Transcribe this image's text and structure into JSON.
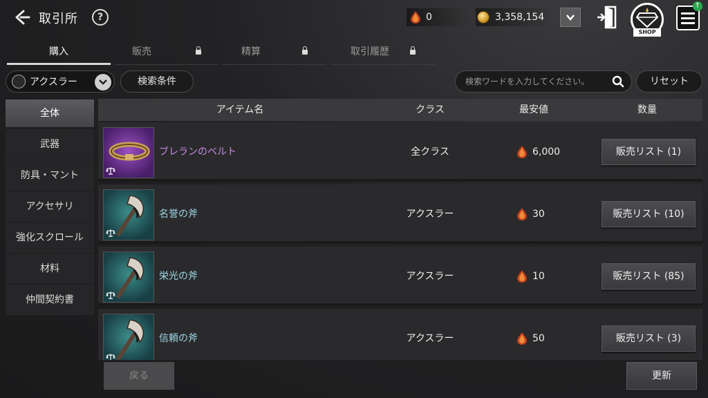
{
  "header": {
    "title": "取引所",
    "help_glyph": "?",
    "gem_amount": "0",
    "gold_amount": "3,358,154",
    "shop_label": "SHOP",
    "notify_glyph": "↑"
  },
  "tabs": [
    {
      "label": "購入",
      "active": true,
      "locked": false
    },
    {
      "label": "販売",
      "active": false,
      "locked": true
    },
    {
      "label": "精算",
      "active": false,
      "locked": true
    },
    {
      "label": "取引履歴",
      "active": false,
      "locked": true
    }
  ],
  "filters": {
    "class_selected": "アクスラー",
    "search_conditions_label": "検索条件",
    "search_placeholder": "検索ワードを入力してください。",
    "reset_label": "リセット"
  },
  "sidebar": {
    "items": [
      {
        "label": "全体",
        "active": true
      },
      {
        "label": "武器",
        "active": false
      },
      {
        "label": "防具・マント",
        "active": false
      },
      {
        "label": "アクセサリ",
        "active": false
      },
      {
        "label": "強化スクロール",
        "active": false
      },
      {
        "label": "材料",
        "active": false
      },
      {
        "label": "仲間契約書",
        "active": false
      }
    ]
  },
  "table": {
    "columns": {
      "name": "アイテム名",
      "class": "クラス",
      "price": "最安値",
      "quantity": "数量"
    },
    "rows": [
      {
        "name": "ブレランのベルト",
        "class": "全クラス",
        "price": "6,000",
        "button": "販売リスト (1)",
        "rarity": "purple",
        "icon": "belt-icon"
      },
      {
        "name": "名誉の斧",
        "class": "アクスラー",
        "price": "30",
        "button": "販売リスト (10)",
        "rarity": "teal",
        "icon": "axe-icon"
      },
      {
        "name": "栄光の斧",
        "class": "アクスラー",
        "price": "10",
        "button": "販売リスト (85)",
        "rarity": "teal",
        "icon": "axe-icon"
      },
      {
        "name": "信頼の斧",
        "class": "アクスラー",
        "price": "50",
        "button": "販売リスト (3)",
        "rarity": "teal",
        "icon": "axe-icon"
      }
    ]
  },
  "footer": {
    "back_label": "戻る",
    "refresh_label": "更新"
  },
  "colors": {
    "gem": "#c2401c",
    "rarity_purple": "#c88ae6",
    "rarity_teal": "#9ed7e6"
  }
}
